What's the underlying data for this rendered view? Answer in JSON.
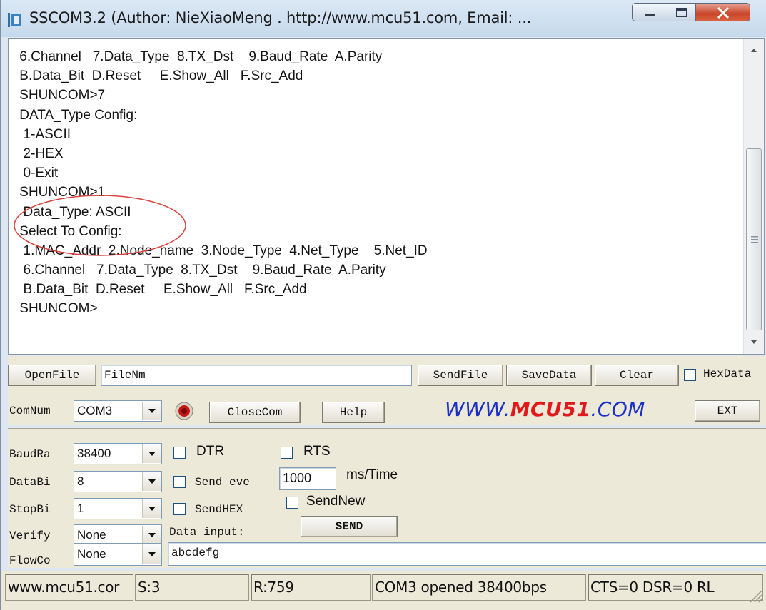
{
  "window": {
    "title": "SSCOM3.2 (Author: NieXiaoMeng . http://www.mcu51.com, Email: ..."
  },
  "terminal": {
    "lines": [
      " 6.Channel   7.Data_Type  8.TX_Dst    9.Baud_Rate  A.Parity",
      " B.Data_Bit  D.Reset     E.Show_All   F.Src_Add",
      " SHUNCOM>7",
      " DATA_Type Config:",
      "  1-ASCII",
      "  2-HEX",
      "  0-Exit",
      " SHUNCOM>1",
      "  Data_Type: ASCII",
      " Select To Config:",
      "  1.MAC_Addr  2.Node_name  3.Node_Type  4.Net_Type    5.Net_ID",
      "  6.Channel   7.Data_Type  8.TX_Dst    9.Baud_Rate  A.Parity",
      "  B.Data_Bit  D.Reset     E.Show_All   F.Src_Add",
      " SHUNCOM>"
    ]
  },
  "file_row": {
    "open_file_label": "OpenFile",
    "file_name_value": "FileNm",
    "send_file_label": "SendFile",
    "save_data_label": "SaveData",
    "clear_label": "Clear",
    "hex_data_label": "HexData"
  },
  "com_row": {
    "com_num_label": "ComNum",
    "com_port_value": "COM3",
    "close_com_label": "CloseCom",
    "help_label": "Help",
    "brand_prefix": "WWW.",
    "brand_main": "MCU51",
    "brand_suffix": ".COM",
    "ext_label": "EXT"
  },
  "settings": {
    "baud_label": "BaudRa",
    "baud_value": "38400",
    "databits_label": "DataBi",
    "databits_value": "8",
    "stopbits_label": "StopBi",
    "stopbits_value": "1",
    "verify_label": "Verify",
    "verify_value": "None",
    "flow_label": "FlowCo",
    "flow_value": "None"
  },
  "send": {
    "dtr_label": "DTR",
    "rts_label": "RTS",
    "send_every_label": "Send eve",
    "interval_value": "1000",
    "interval_unit": "ms/Time",
    "send_hex_label": "SendHEX",
    "send_new_label": "SendNew",
    "data_input_label": "Data input:",
    "send_button_label": "SEND",
    "data_input_value": "abcdefg"
  },
  "statusbar": {
    "site": "www.mcu51.cor",
    "sent": "S:3",
    "received": "R:759",
    "port_status": "COM3 opened 38400bps",
    "lines_status": "CTS=0 DSR=0 RL"
  },
  "colors": {
    "brand_blue": "#1a2fc9",
    "brand_red": "#e01a1a",
    "annotation_red": "#d9413a",
    "status_lamp": "#c81515"
  }
}
